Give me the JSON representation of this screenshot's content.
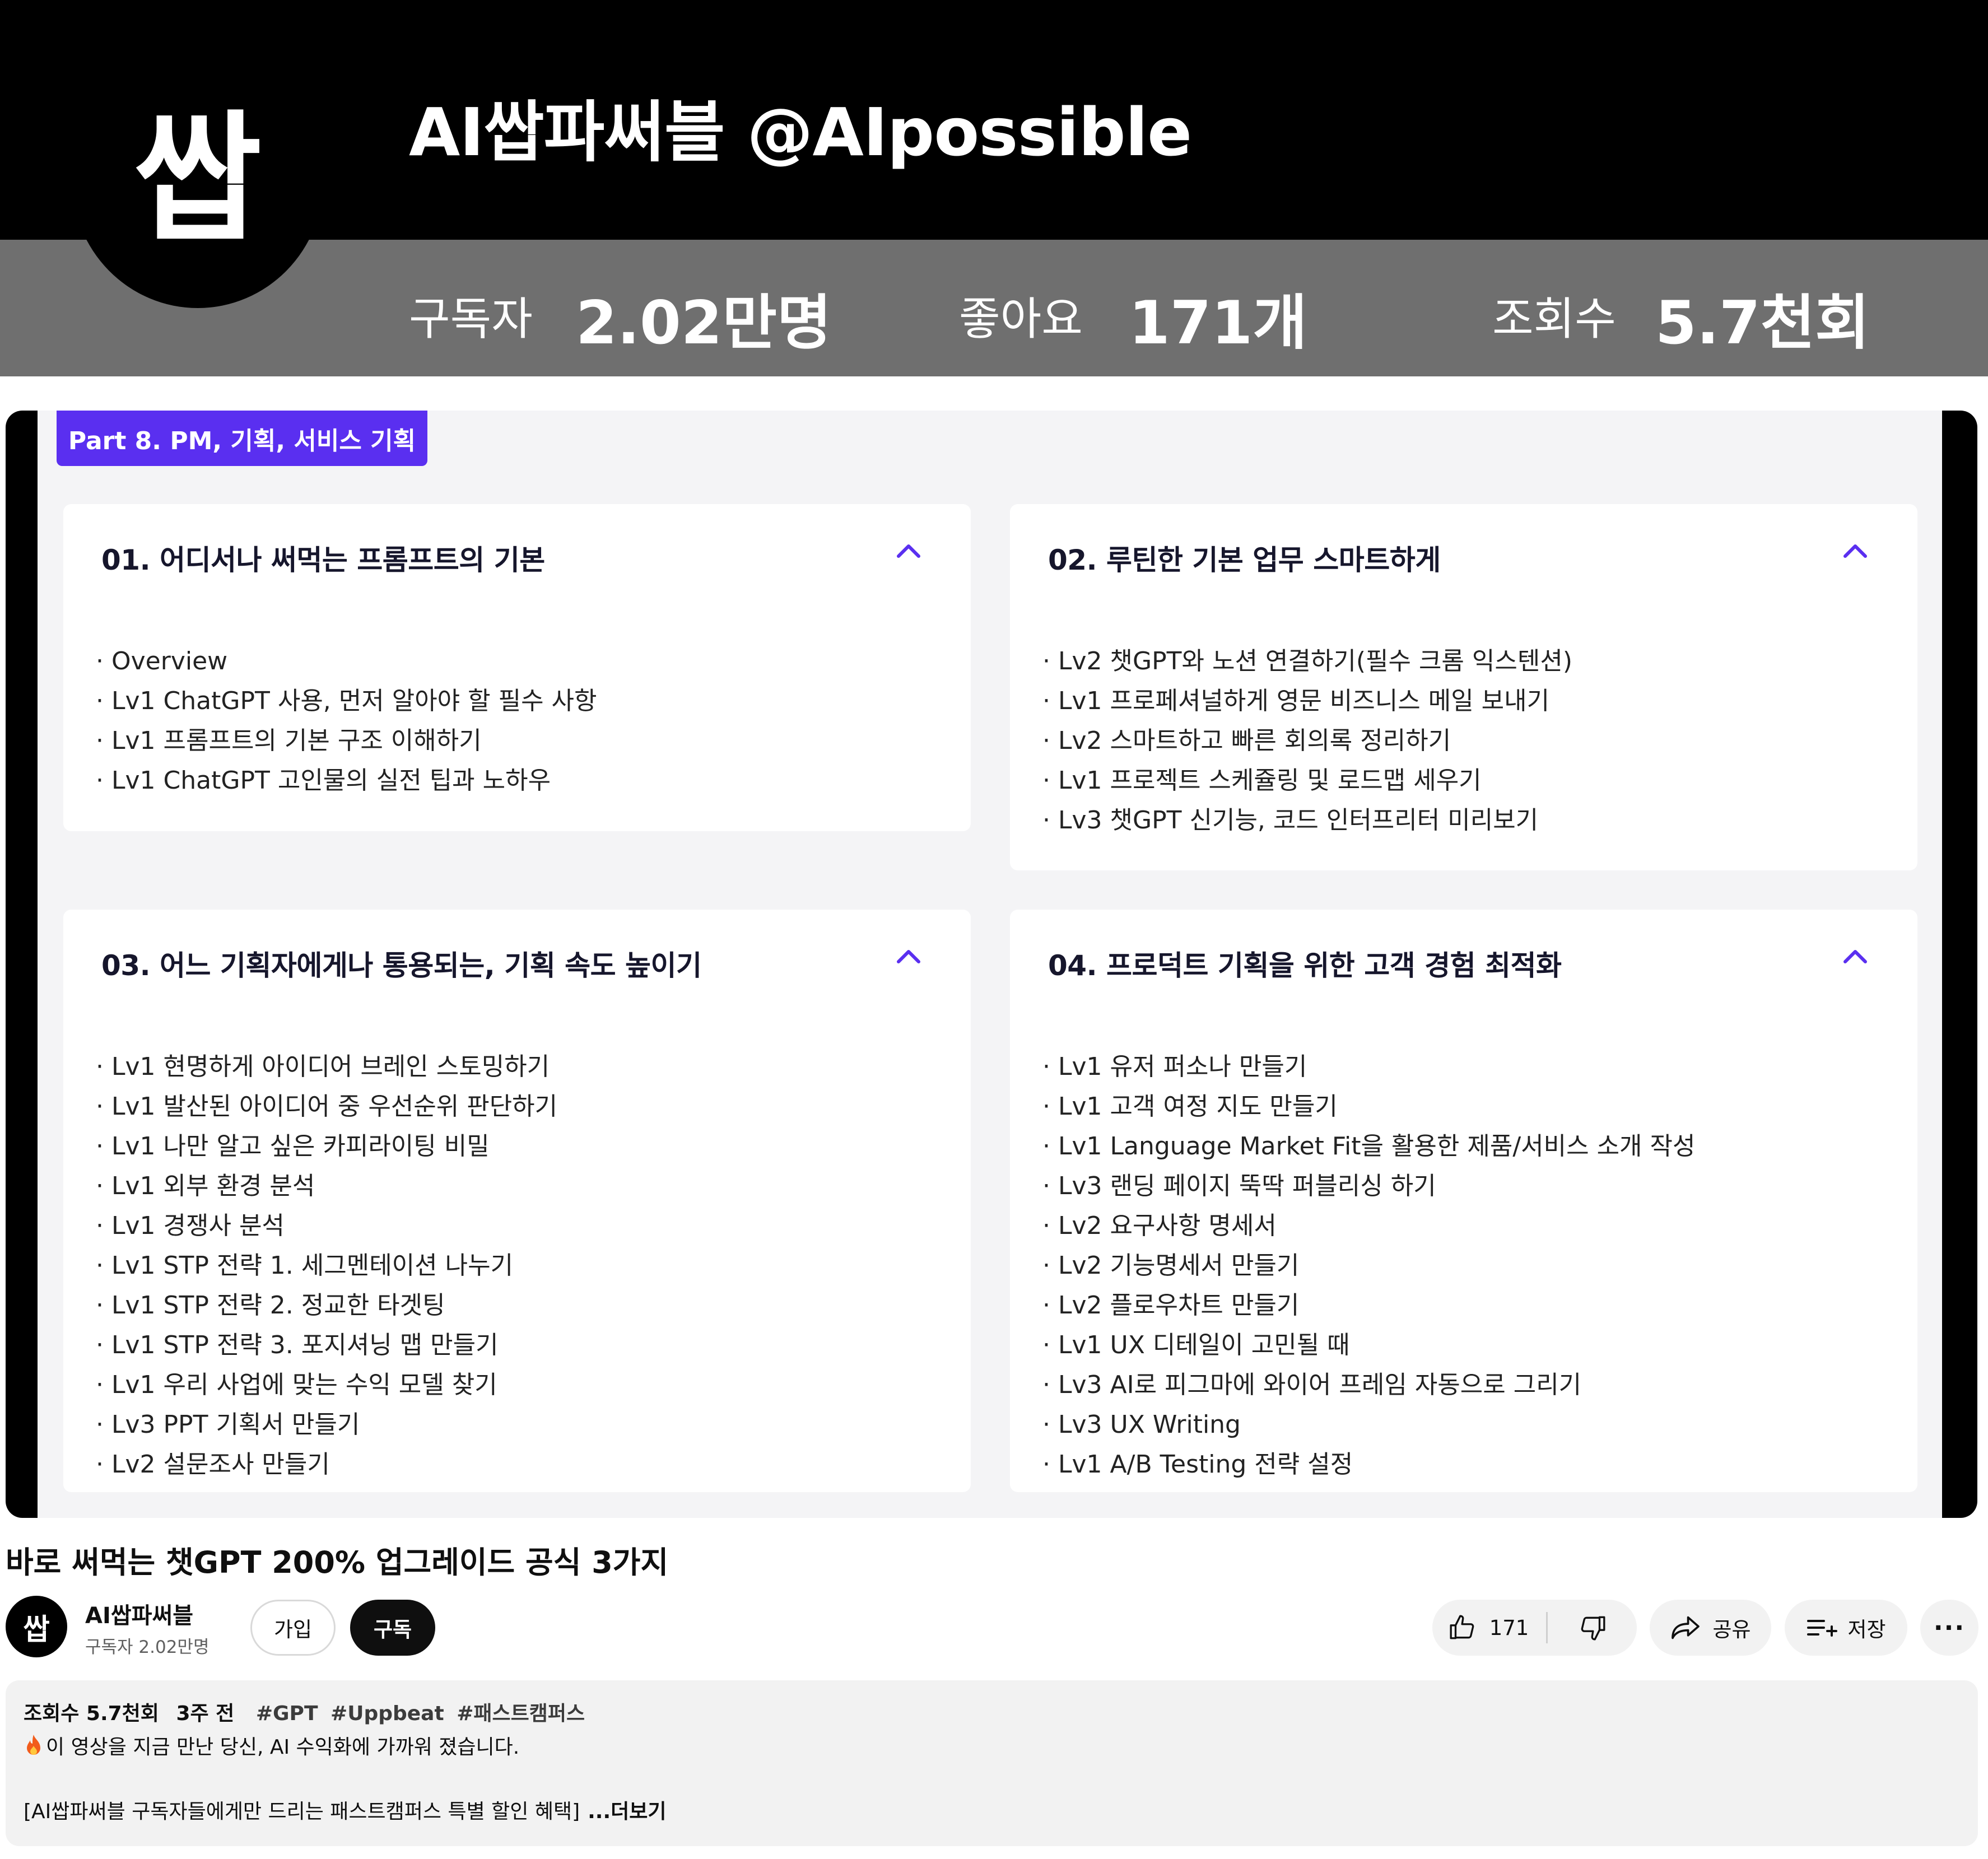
{
  "banner": {
    "logo_text": "쌉",
    "channel_title": "AI쌉파써블 @AIpossible",
    "stats": [
      {
        "label": "구독자",
        "value": "2.02만명"
      },
      {
        "label": "좋아요",
        "value": "171개"
      },
      {
        "label": "조회수",
        "value": "5.7천회"
      }
    ]
  },
  "slide": {
    "part_badge": "Part 8. PM, 기획, 서비스 기획",
    "cards": [
      {
        "title": "01. 어디서나 써먹는 프롬프트의 기본",
        "items": [
          "Overview",
          "Lv1 ChatGPT 사용, 먼저 알아야 할 필수 사항",
          "Lv1 프롬프트의 기본 구조 이해하기",
          "Lv1 ChatGPT 고인물의 실전 팁과 노하우"
        ]
      },
      {
        "title": "02. 루틴한 기본 업무 스마트하게",
        "items": [
          "Lv2 챗GPT와 노션 연결하기(필수 크롬 익스텐션)",
          "Lv1 프로페셔널하게 영문 비즈니스 메일 보내기",
          "Lv2 스마트하고 빠른 회의록 정리하기",
          "Lv1 프로젝트 스케쥴링 및 로드맵 세우기",
          "Lv3 챗GPT 신기능, 코드 인터프리터 미리보기"
        ]
      },
      {
        "title": "03. 어느 기획자에게나 통용되는, 기획 속도 높이기",
        "items": [
          "Lv1 현명하게 아이디어 브레인 스토밍하기",
          "Lv1 발산된 아이디어 중 우선순위 판단하기",
          "Lv1 나만 알고 싶은 카피라이팅 비밀",
          "Lv1 외부 환경 분석",
          "Lv1 경쟁사 분석",
          "Lv1 STP 전략 1. 세그멘테이션 나누기",
          "Lv1 STP 전략 2. 정교한 타겟팅",
          "Lv1 STP 전략 3. 포지셔닝 맵 만들기",
          "Lv1 우리 사업에 맞는 수익 모델 찾기",
          "Lv3 PPT 기획서 만들기",
          "Lv2 설문조사 만들기"
        ]
      },
      {
        "title": "04. 프로덕트 기획을 위한 고객 경험 최적화",
        "items": [
          "Lv1 유저 퍼소나 만들기",
          "Lv1 고객 여정 지도 만들기",
          "Lv1 Language Market Fit을 활용한 제품/서비스 소개 작성",
          "Lv3 랜딩 페이지 뚝딱 퍼블리싱 하기",
          "Lv2 요구사항 명세서",
          "Lv2 기능명세서 만들기",
          "Lv2 플로우차트 만들기",
          "Lv1 UX 디테일이 고민될 때",
          "Lv3 AI로 피그마에 와이어 프레임 자동으로 그리기",
          "Lv3 UX Writing",
          "Lv1 A/B Testing 전략 설정"
        ]
      }
    ],
    "accent_color": "#5a2ff0"
  },
  "video": {
    "title": "바로 써먹는 챗GPT 200% 업그레이드 공식 3가지"
  },
  "channel": {
    "avatar_text": "쌉",
    "name": "AI쌉파써블",
    "subscribers": "구독자 2.02만명",
    "join_label": "가입",
    "subscribe_label": "구독"
  },
  "actions": {
    "like_count": "171",
    "share_label": "공유",
    "save_label": "저장",
    "more_label": "···"
  },
  "description": {
    "views": "조회수 5.7천회",
    "age": "3주 전",
    "hashtags": [
      "#GPT",
      "#Uppbeat",
      "#패스트캠퍼스"
    ],
    "line1": "이 영상을 지금 만난 당신,  AI 수익화에 가까워 졌습니다.",
    "line2": "[AI쌉파써블 구독자들에게만 드리는 패스트캠퍼스 특별 할인 혜택]",
    "more_label": "...더보기"
  }
}
